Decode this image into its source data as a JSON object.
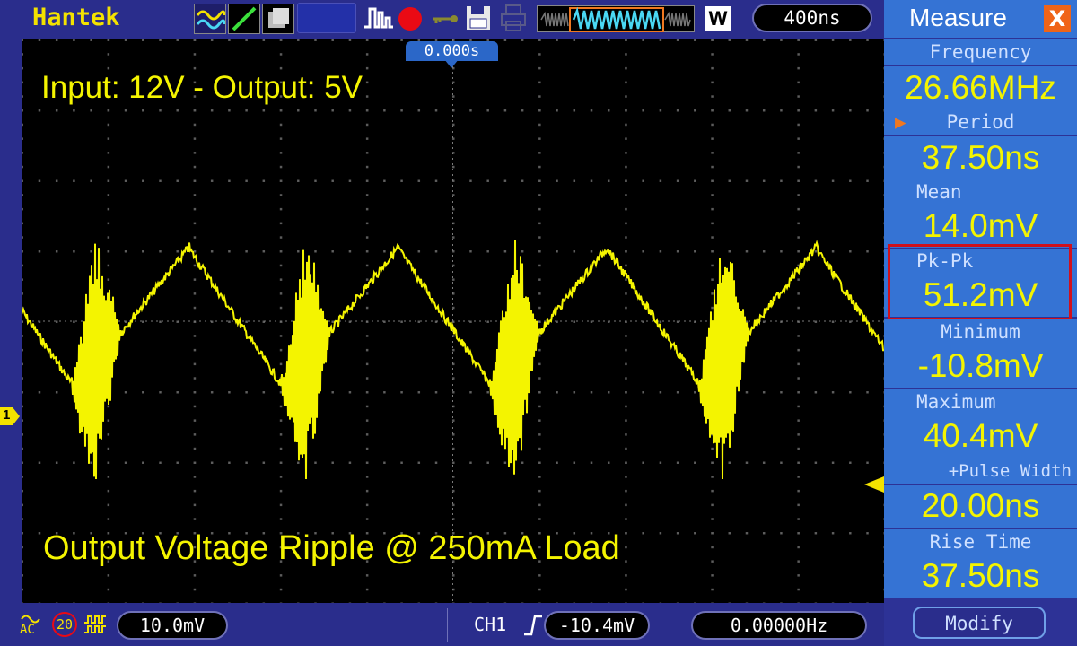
{
  "brand": "Hantek",
  "toolbar": {
    "timebase": "400ns",
    "window_button": "W",
    "trigger_position": "0.000s"
  },
  "screen": {
    "annotation_top": "Input: 12V - Output: 5V",
    "annotation_bottom": "Output Voltage Ripple @ 250mA Load",
    "channel_marker": "1",
    "trace_color": "#f4f400"
  },
  "measure": {
    "title": "Measure",
    "close_label": "X",
    "items": [
      {
        "label": "Frequency",
        "value": "26.66MHz"
      },
      {
        "label": "Period",
        "value": "37.50ns"
      },
      {
        "label": "Mean",
        "value": "14.0mV"
      },
      {
        "label": "Pk-Pk",
        "value": "51.2mV"
      },
      {
        "label": "Minimum",
        "value": "-10.8mV"
      },
      {
        "label": "Maximum",
        "value": "40.4mV"
      },
      {
        "label": "+Pulse Width",
        "value": "20.00ns"
      },
      {
        "label": "Rise Time",
        "value": "37.50ns"
      }
    ],
    "selected_item": "Pk-Pk",
    "pointer_item": "Period",
    "modify_label": "Modify"
  },
  "bottom": {
    "coupling": "AC",
    "bandwidth_limit": "20",
    "volts_div": "10.0mV",
    "trigger_source": "CH1",
    "trigger_level": "-10.4mV",
    "trigger_freq": "0.00000Hz"
  },
  "colors": {
    "trace": "#f4f400",
    "panel": "#3573d4",
    "highlight": "#d0101c",
    "brand": "#f4e200"
  }
}
